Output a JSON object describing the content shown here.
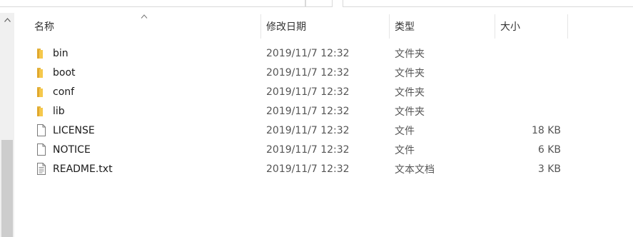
{
  "header": {
    "name": "名称",
    "modified": "修改日期",
    "type": "类型",
    "size": "大小",
    "sort_indicator": "^"
  },
  "scrollbar": {
    "up_arrow": "▲"
  },
  "files": [
    {
      "name": "bin",
      "modified": "2019/11/7 12:32",
      "type": "文件夹",
      "size": "",
      "icon": "folder-icon"
    },
    {
      "name": "boot",
      "modified": "2019/11/7 12:32",
      "type": "文件夹",
      "size": "",
      "icon": "folder-icon"
    },
    {
      "name": "conf",
      "modified": "2019/11/7 12:32",
      "type": "文件夹",
      "size": "",
      "icon": "folder-icon"
    },
    {
      "name": "lib",
      "modified": "2019/11/7 12:32",
      "type": "文件夹",
      "size": "",
      "icon": "folder-icon"
    },
    {
      "name": "LICENSE",
      "modified": "2019/11/7 12:32",
      "type": "文件",
      "size": "18 KB",
      "icon": "file-icon"
    },
    {
      "name": "NOTICE",
      "modified": "2019/11/7 12:32",
      "type": "文件",
      "size": "6 KB",
      "icon": "file-icon"
    },
    {
      "name": "README.txt",
      "modified": "2019/11/7 12:32",
      "type": "文本文档",
      "size": "3 KB",
      "icon": "text-file-icon"
    }
  ]
}
